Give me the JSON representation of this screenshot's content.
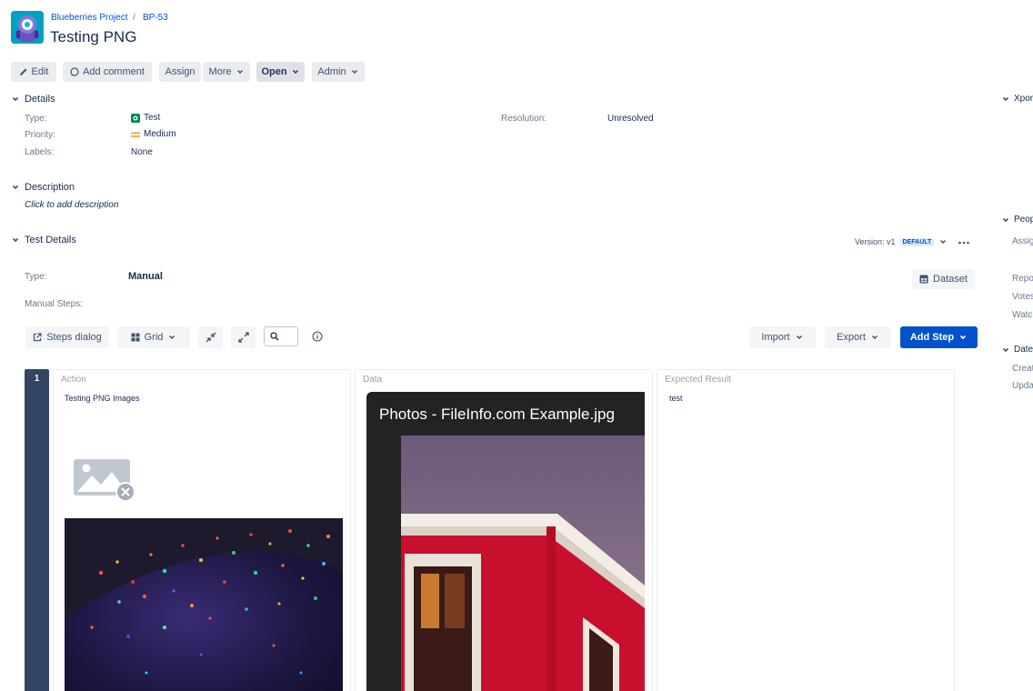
{
  "header": {
    "project": "Blueberries Project",
    "separator": "/",
    "issue_key": "BP-53",
    "title": "Testing PNG"
  },
  "toolbar": {
    "edit": "Edit",
    "add_comment": "Add comment",
    "assign": "Assign",
    "more": "More",
    "status": "Open",
    "admin": "Admin"
  },
  "details": {
    "heading": "Details",
    "type_label": "Type:",
    "type_value": "Test",
    "priority_label": "Priority:",
    "priority_value": "Medium",
    "labels_label": "Labels:",
    "labels_value": "None",
    "resolution_label": "Resolution:",
    "resolution_value": "Unresolved"
  },
  "description": {
    "heading": "Description",
    "placeholder": "Click to add description"
  },
  "test_details": {
    "heading": "Test Details",
    "version": "Version: v1",
    "version_badge": "DEFAULT",
    "type_label": "Type:",
    "type_value": "Manual",
    "dataset": "Dataset",
    "manual_steps_label": "Manual Steps:"
  },
  "steps_toolbar": {
    "steps_dialog": "Steps dialog",
    "grid": "Grid",
    "import": "Import",
    "export": "Export",
    "add_step": "Add Step"
  },
  "step": {
    "number": "1",
    "action_header": "Action",
    "action_text": "Testing PNG Images",
    "data_header": "Data",
    "data_caption": "Photos - FileInfo.com Example.jpg",
    "expected_header": "Expected Result",
    "expected_text": "test"
  },
  "right_panel": {
    "xporter": "Xpor",
    "people": "Peop",
    "assignee": "Assig",
    "reporter": "Repo",
    "votes": "Votes",
    "watchers": "Watc",
    "dates": "Date",
    "created": "Creat",
    "updated": "Upda"
  },
  "colors": {
    "link": "#0052cc",
    "primary_button": "#0052cc",
    "step_number_bar": "#344563"
  }
}
